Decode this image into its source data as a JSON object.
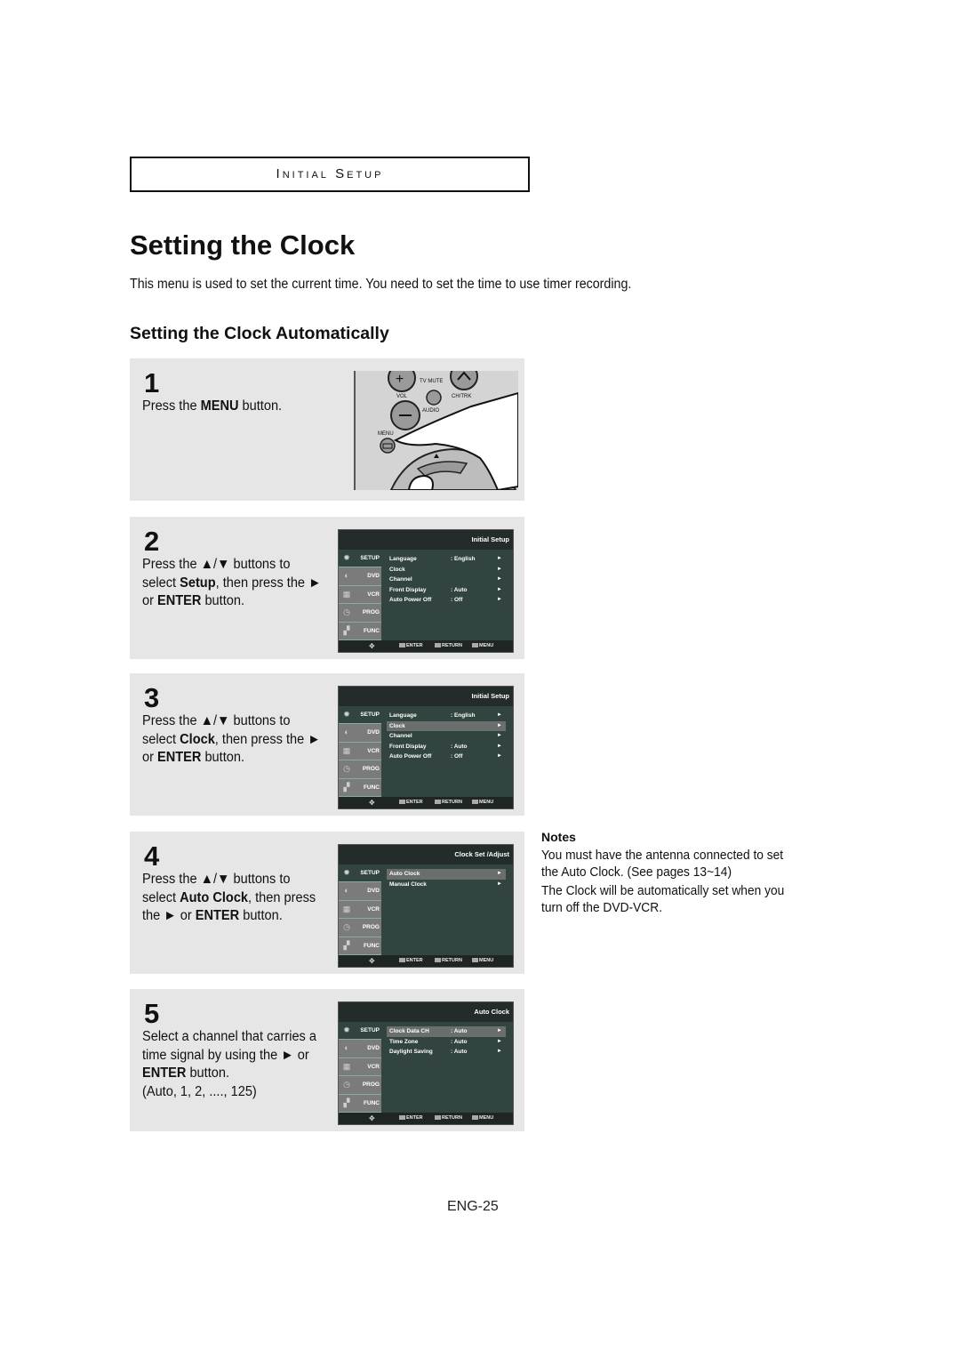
{
  "section_header": "Initial Setup",
  "title": "Setting the Clock",
  "intro": "This menu is used to set the current time. You need to set the time to use timer recording.",
  "subtitle": "Setting the Clock Automatically",
  "steps": [
    {
      "number": "1",
      "text_parts": [
        "Press the ",
        "MENU",
        " button."
      ],
      "remote": {
        "labels": {
          "tv_mute": "TV MUTE",
          "vol": "VOL",
          "ch_trk": "CH/TRK",
          "audio": "AUDIO",
          "menu": "MENU"
        }
      }
    },
    {
      "number": "2",
      "text_parts": [
        "Press the ▲/▼ buttons to select ",
        "Setup",
        ", then press the ► or ",
        "ENTER",
        " button."
      ],
      "osd": {
        "header": "Initial Setup",
        "rows": [
          {
            "key": "Language",
            "value": ": English",
            "arrow": "►",
            "highlight": false
          },
          {
            "key": "Clock",
            "value": "",
            "arrow": "►",
            "highlight": false
          },
          {
            "key": "Channel",
            "value": "",
            "arrow": "►",
            "highlight": false
          },
          {
            "key": "Front Display",
            "value": ": Auto",
            "arrow": "►",
            "highlight": false
          },
          {
            "key": "Auto Power Off",
            "value": ": Off",
            "arrow": "►",
            "highlight": false
          }
        ]
      }
    },
    {
      "number": "3",
      "text_parts": [
        "Press the ▲/▼ buttons to select ",
        "Clock",
        ", then press the ► or ",
        "ENTER",
        " button."
      ],
      "osd": {
        "header": "Initial Setup",
        "rows": [
          {
            "key": "Language",
            "value": ": English",
            "arrow": "►",
            "highlight": false
          },
          {
            "key": "Clock",
            "value": "",
            "arrow": "►",
            "highlight": true
          },
          {
            "key": "Channel",
            "value": "",
            "arrow": "►",
            "highlight": false
          },
          {
            "key": "Front Display",
            "value": ": Auto",
            "arrow": "►",
            "highlight": false
          },
          {
            "key": "Auto Power Off",
            "value": ": Off",
            "arrow": "►",
            "highlight": false
          }
        ]
      }
    },
    {
      "number": "4",
      "text_parts": [
        "Press the ▲/▼ buttons to select ",
        "Auto Clock",
        ", then press the ► or ",
        "ENTER",
        " button."
      ],
      "osd": {
        "header": "Clock Set /Adjust",
        "rows": [
          {
            "key": "Auto Clock",
            "value": "",
            "arrow": "►",
            "highlight": true
          },
          {
            "key": "Manual Clock",
            "value": "",
            "arrow": "►",
            "highlight": false
          }
        ]
      }
    },
    {
      "number": "5",
      "text_parts": [
        "Select a channel that carries a time signal by using the ► or ",
        "ENTER",
        " button.",
        "(Auto, 1, 2, ...., 125)"
      ],
      "osd": {
        "header": "Auto Clock",
        "rows": [
          {
            "key": "Clock Data CH",
            "value": ": Auto",
            "arrow": "►",
            "highlight": true
          },
          {
            "key": "Time Zone",
            "value": ": Auto",
            "arrow": "►",
            "highlight": false
          },
          {
            "key": "Daylight  Saving",
            "value": ": Auto",
            "arrow": "►",
            "highlight": false
          }
        ]
      }
    }
  ],
  "osd_sidebar": [
    {
      "label": "SETUP",
      "icon": "gear-icon"
    },
    {
      "label": "DVD",
      "icon": "dvd-icon"
    },
    {
      "label": "VCR",
      "icon": "vcr-icon"
    },
    {
      "label": "PROG",
      "icon": "clock-icon"
    },
    {
      "label": "FUNC",
      "icon": "function-icon"
    }
  ],
  "osd_footer": {
    "enter": "ENTER",
    "return": "RETURN",
    "menu": "MENU"
  },
  "notes": {
    "title": "Notes",
    "items": [
      "You must have the antenna connected to set\nthe Auto Clock. (See pages 13~14)",
      "The Clock will be automatically set when you\nturn off the DVD-VCR."
    ]
  },
  "page_number": "ENG-25"
}
